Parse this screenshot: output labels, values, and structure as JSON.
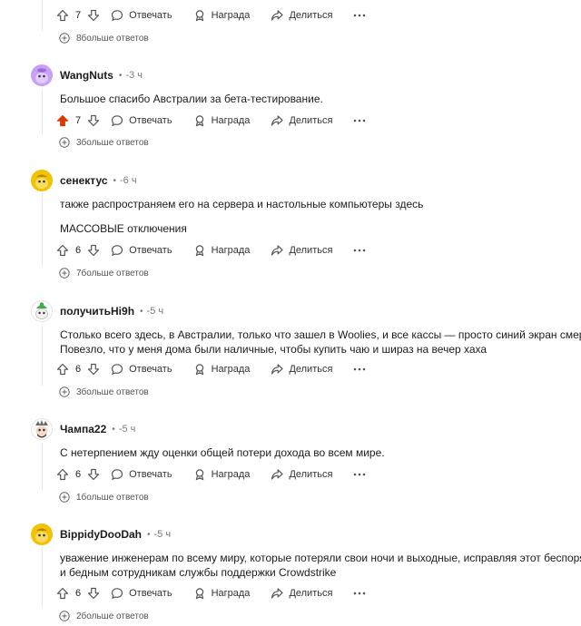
{
  "actions": {
    "reply": "Отвечать",
    "award": "Награда",
    "share": "Делиться"
  },
  "top_partial": {
    "votes": "7",
    "more_replies": "8больше ответов"
  },
  "comments": [
    {
      "author": "WangNuts",
      "time": "-3 ч",
      "lines": [
        "Большое спасибо Австралии за бета-тестирование."
      ],
      "votes": "7",
      "upvoted": true,
      "more_replies": "3больше ответов"
    },
    {
      "author": "сенектус",
      "time": "-6 ч",
      "lines": [
        "также распространяем его на сервера и настольные компьютеры здесь",
        "МАССОВЫЕ отключения"
      ],
      "votes": "6",
      "upvoted": false,
      "more_replies": "7больше ответов"
    },
    {
      "author": "получитьHi9h",
      "time": "-5 ч",
      "lines": [
        "Столько всего здесь, в Австралии, только что зашел в Woolies, и все кассы — просто синий экран смерти.",
        "Повезло, что у меня дома были наличные, чтобы купить чаю и шираз на вечер хаха"
      ],
      "votes": "6",
      "upvoted": false,
      "more_replies": "3больше ответов"
    },
    {
      "author": "Чампа22",
      "time": "-5 ч",
      "lines": [
        "С нетерпением жду оценки общей потери дохода во всем мире."
      ],
      "votes": "6",
      "upvoted": false,
      "more_replies": "1больше ответов"
    },
    {
      "author": "BippidyDooDah",
      "time": "-5 ч",
      "lines": [
        "уважение инженерам по всему миру, которые потеряли свои ночи и выходные, исправляя этот беспорядок,",
        "и бедным сотрудникам службы поддержки Crowdstrike"
      ],
      "votes": "6",
      "upvoted": false,
      "more_replies": "2больше ответов"
    }
  ],
  "colors": {
    "upvote_active": "#d93a00",
    "icon": "#555555",
    "thread_line": "#e5e7e8",
    "avatar_purple": "#c9a0f5",
    "avatar_yellow": "#f2c200"
  }
}
